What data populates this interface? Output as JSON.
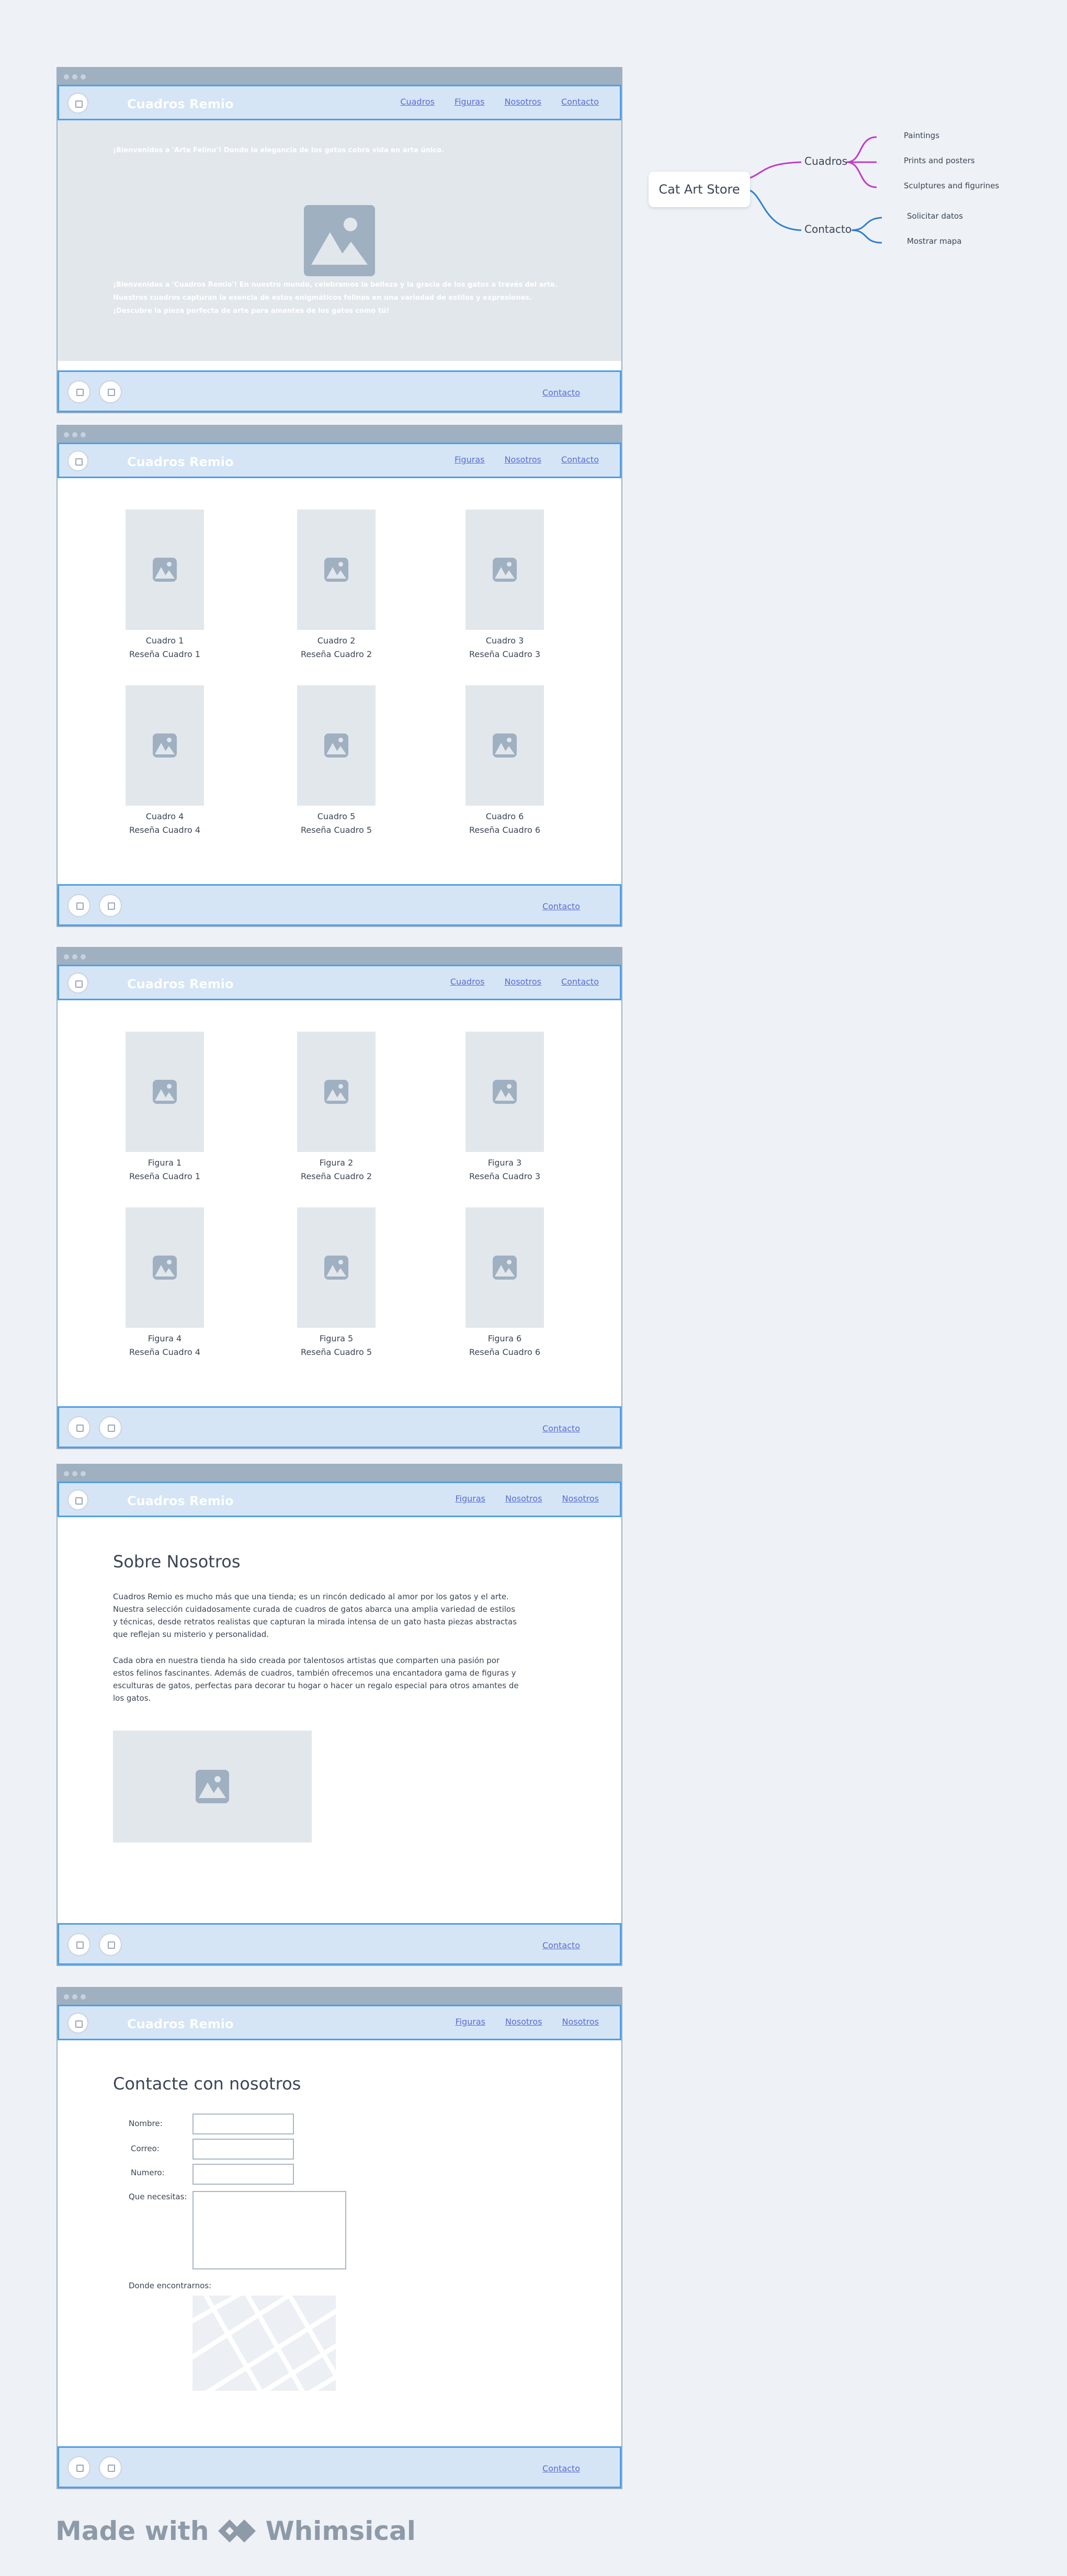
{
  "brand": "Cuadros Remio",
  "nav_home": [
    "Cuadros",
    "Figuras",
    "Nosotros",
    "Contacto"
  ],
  "nav_cuadros": [
    "Figuras",
    "Nosotros",
    "Contacto"
  ],
  "nav_figuras": [
    "Cuadros",
    "Nosotros",
    "Contacto"
  ],
  "nav_nosotros": [
    "Figuras",
    "Nosotros",
    "Nosotros"
  ],
  "nav_contacto": [
    "Figuras",
    "Nosotros",
    "Nosotros"
  ],
  "footer_link": "Contacto",
  "home": {
    "tagline": "¡Bienvenidos a 'Arte Felino'! Donde la elegancia de los gatos cobra vida en arte único.",
    "intro": [
      "¡Bienvenidos a 'Cuadros Remio'! En nuestro mundo, celebramos la belleza y la gracia de los gatos a través del arte.",
      "Nuestros cuadros capturan la esencia de estos enigmáticos felinos en una variedad de estilos y expresiones.",
      "¡Descubre la pieza perfecta de arte para amantes de los gatos como tú!"
    ]
  },
  "cuadros": [
    {
      "name": "Cuadro 1",
      "review": "Reseña Cuadro 1"
    },
    {
      "name": "Cuadro 2",
      "review": "Reseña Cuadro 2"
    },
    {
      "name": "Cuadro 3",
      "review": "Reseña Cuadro 3"
    },
    {
      "name": "Cuadro 4",
      "review": "Reseña Cuadro 4"
    },
    {
      "name": "Cuadro 5",
      "review": "Reseña Cuadro 5"
    },
    {
      "name": "Cuadro 6",
      "review": "Reseña Cuadro 6"
    }
  ],
  "figuras": [
    {
      "name": "Figura 1",
      "review": "Reseña Cuadro 1"
    },
    {
      "name": "Figura  2",
      "review": "Reseña Cuadro 2"
    },
    {
      "name": "Figura  3",
      "review": "Reseña Cuadro 3"
    },
    {
      "name": "Figura  4",
      "review": "Reseña Cuadro 4"
    },
    {
      "name": "Figura  5",
      "review": "Reseña Cuadro 5"
    },
    {
      "name": "Figura 6",
      "review": "Reseña Cuadro 6"
    }
  ],
  "about": {
    "title": "Sobre Nosotros",
    "p1": [
      "Cuadros Remio es mucho más que una tienda; es un rincón dedicado al amor por los gatos y el arte.",
      "Nuestra selección cuidadosamente curada de cuadros de gatos abarca una amplia variedad de estilos",
      "y técnicas, desde retratos realistas que capturan la mirada intensa de un gato hasta piezas abstractas",
      "que reflejan su misterio y personalidad."
    ],
    "p2": [
      "Cada obra en nuestra tienda ha sido creada por talentosos artistas que comparten una pasión por",
      "estos felinos fascinantes. Además de cuadros, también ofrecemos una encantadora gama de figuras y",
      "esculturas de gatos, perfectas para decorar tu hogar o hacer un regalo especial para otros amantes de",
      "los gatos."
    ]
  },
  "contact": {
    "title": "Contacte con nosotros",
    "name_label": "Nombre:",
    "email_label": "Correo:",
    "phone_label": "Numero:",
    "needs_label": "Que necesitas:",
    "map_label": "Donde encontrarnos:"
  },
  "mindmap": {
    "root": "Cat Art Store",
    "branches": [
      {
        "label": "Cuadros",
        "color": "#c23bc8",
        "children": [
          "Paintings",
          "Prints and posters",
          "Sculptures and figurines"
        ]
      },
      {
        "label": "Contacto",
        "color": "#2e7fd1",
        "children": [
          "Solicitar datos",
          "Mostrar mapa"
        ]
      }
    ]
  },
  "watermark": {
    "prefix": "Made with",
    "brand": "Whimsical"
  },
  "colors": {
    "accent": "#4f9ee6",
    "header_bg": "#d5e5f6",
    "link": "#5b6bd6",
    "placeholder": "#e2e7ec"
  }
}
